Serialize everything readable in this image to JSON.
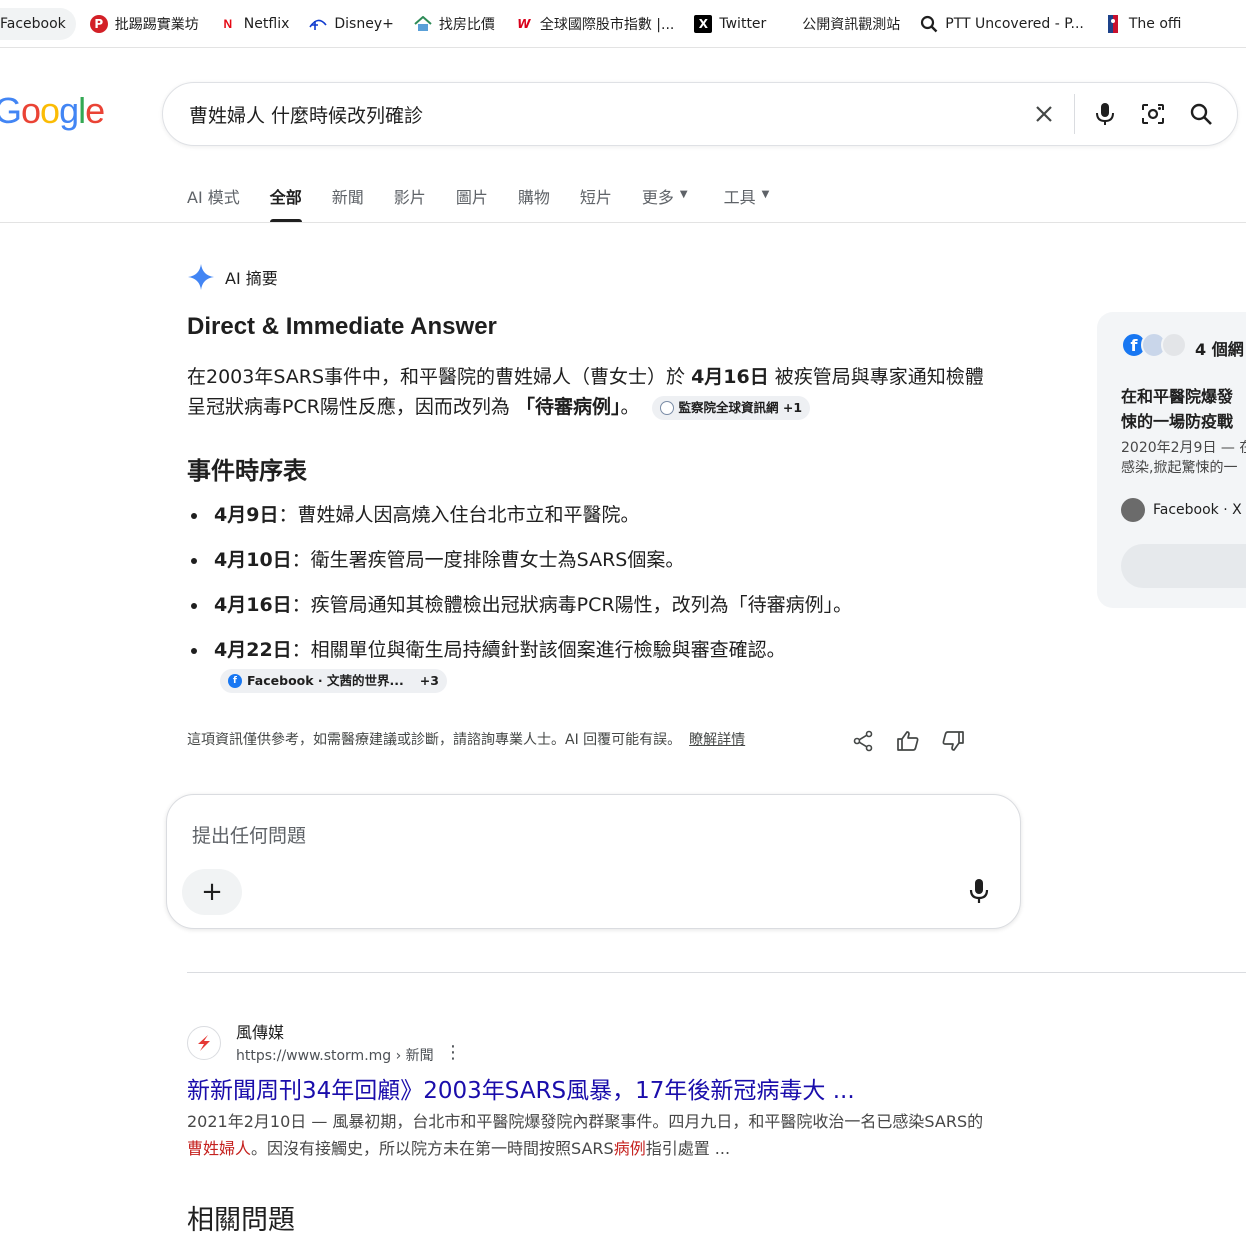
{
  "bookmarks": [
    {
      "label": "Facebook",
      "icon": "facebook-icon"
    },
    {
      "label": "批踢踢實業坊",
      "icon": "ptt-icon"
    },
    {
      "label": "Netflix",
      "icon": "netflix-icon"
    },
    {
      "label": "Disney+",
      "icon": "disney-icon"
    },
    {
      "label": "找房比價",
      "icon": "house-icon"
    },
    {
      "label": "全球國際股市指數 |...",
      "icon": "w-icon"
    },
    {
      "label": "Twitter",
      "icon": "x-icon"
    },
    {
      "label": "公開資訊觀測站",
      "icon": "none"
    },
    {
      "label": "PTT Uncovered - P...",
      "icon": "magnifier-icon"
    },
    {
      "label": "The offi",
      "icon": "nba-icon"
    }
  ],
  "logo": "Google",
  "search": {
    "query": "曹姓婦人 什麼時候改列確診"
  },
  "tabs": [
    {
      "label": "AI 模式",
      "active": false
    },
    {
      "label": "全部",
      "active": true
    },
    {
      "label": "新聞",
      "active": false
    },
    {
      "label": "影片",
      "active": false
    },
    {
      "label": "圖片",
      "active": false
    },
    {
      "label": "購物",
      "active": false
    },
    {
      "label": "短片",
      "active": false
    },
    {
      "label": "更多",
      "active": false,
      "caret": true
    },
    {
      "label": "工具",
      "active": false,
      "caret": true
    }
  ],
  "ai_overview": {
    "header": "AI 摘要",
    "title": "Direct & Immediate Answer",
    "answer_pre": "在2003年SARS事件中，和平醫院的曹姓婦人（曹女士）於 ",
    "answer_date": "4月16日",
    "answer_mid": " 被疾管局與專家通知檢體呈冠狀病毒PCR陽性反應，因而改列為 ",
    "answer_case": "「待審病例」",
    "answer_end": "。",
    "answer_chip": {
      "label": "監察院全球資訊網",
      "extra": "+1"
    },
    "timeline_title": "事件時序表",
    "timeline": [
      {
        "date": "4月9日",
        "text": "：曹姓婦人因高燒入住台北市立和平醫院。"
      },
      {
        "date": "4月10日",
        "text": "：衛生署疾管局一度排除曹女士為SARS個案。"
      },
      {
        "date": "4月16日",
        "text": "：疾管局通知其檢體檢出冠狀病毒PCR陽性，改列為「待審病例」。"
      },
      {
        "date": "4月22日",
        "text": "：相關單位與衛生局持續針對該個案進行檢驗與審查確認。"
      }
    ],
    "timeline_chip": {
      "label": "Facebook · 文茜的世界...",
      "extra": "+3"
    },
    "disclaimer": "這項資訊僅供參考，如需醫療建議或診斷，請諮詢專業人士。AI 回覆可能有誤。",
    "learn_more": "瞭解詳情"
  },
  "ask": {
    "placeholder": "提出任何問題",
    "plus": "+"
  },
  "result": {
    "site": "風傳媒",
    "url": "https://www.storm.mg › 新聞",
    "title": "新新聞周刊34年回顧》2003年SARS風暴，17年後新冠病毒大 ...",
    "snippet_1": "2021年2月10日 — 風暴初期，台北市和平醫院爆發院內群聚事件。四月九日，和平醫院收治一名已感染SARS的",
    "snippet_hl1": "曹姓婦人",
    "snippet_2": "。因沒有接觸史，所以院方未在第一時間按照SARS",
    "snippet_hl2": "病例",
    "snippet_3": "指引處置 ..."
  },
  "related": "相關問題",
  "side_card": {
    "count": "4 個網",
    "title_1": "在和平醫院爆發",
    "title_2": "悚的一場防疫戰",
    "snip_1": "2020年2月9日 — 在",
    "snip_2": "感染,掀起驚悚的一",
    "source": "Facebook · X"
  },
  "colors": {
    "link": "#1a0dab",
    "highlight": "#c5221f",
    "accent_blue": "#4285f4"
  }
}
